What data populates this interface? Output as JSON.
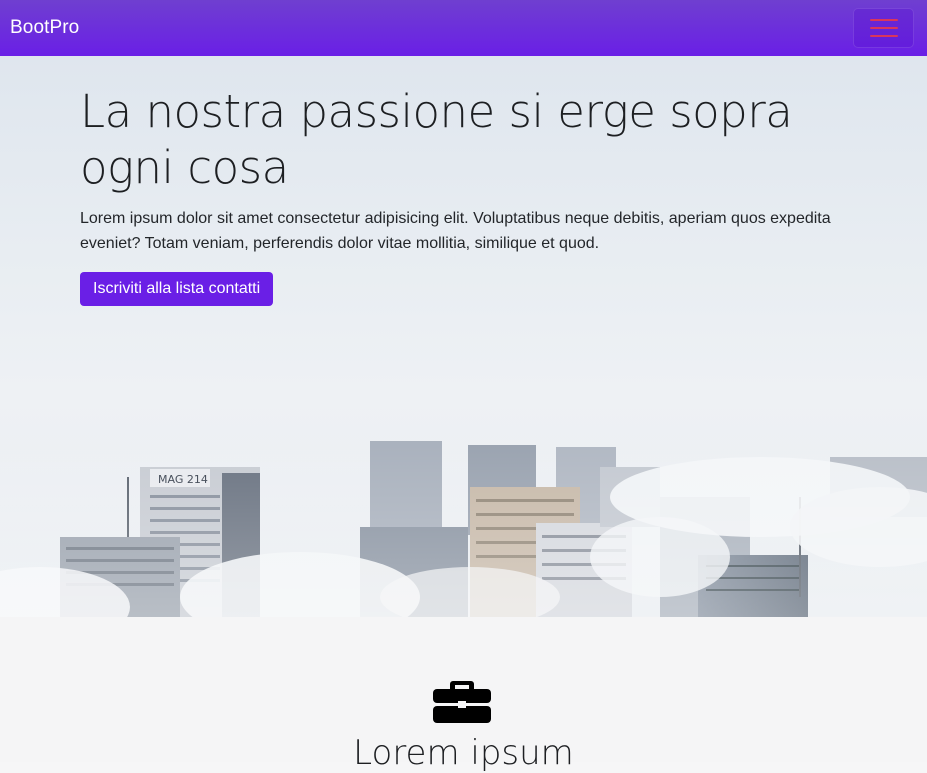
{
  "navbar": {
    "brand": "BootPro",
    "toggler_icon": "hamburger-menu-icon"
  },
  "hero": {
    "title": "La nostra passione si erge sopra ogni cosa",
    "text": "Lorem ipsum dolor sit amet consectetur adipisicing elit. Voluptatibus neque debitis, aperiam quos expedita eveniet? Totam veniam, perferendis dolor vitae mollitia, similique et quod.",
    "cta_label": "Iscriviti alla lista contatti",
    "building_sign": "MAG 214"
  },
  "section": {
    "icon": "briefcase-icon",
    "title": "Lorem ipsum"
  },
  "colors": {
    "primary": "#6a1fe6",
    "toggler_bar": "#d9365c"
  }
}
